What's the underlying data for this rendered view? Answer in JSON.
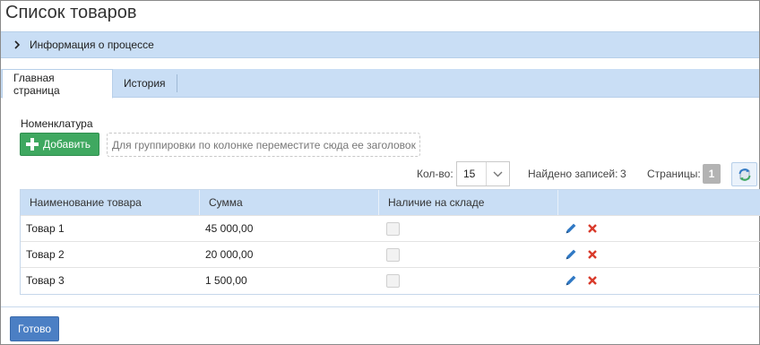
{
  "page": {
    "title": "Список товаров"
  },
  "process_panel": {
    "label": "Информация о процессе",
    "expanded": false
  },
  "tabs": [
    {
      "label": "Главная страница",
      "active": true
    },
    {
      "label": "История",
      "active": false
    }
  ],
  "nomenclature": {
    "section_label": "Номенклатура",
    "add_button": "Добавить",
    "group_hint": "Для группировки по колонке переместите сюда ее заголовок"
  },
  "pager": {
    "count_label": "Кол-во:",
    "count_value": "15",
    "found_label": "Найдено записей:",
    "found_value": "3",
    "pages_label": "Страницы:",
    "current_page": "1"
  },
  "table": {
    "columns": [
      "Наименование товара",
      "Сумма",
      "Наличие на складе",
      ""
    ],
    "rows": [
      {
        "name": "Товар 1",
        "sum": "45 000,00",
        "in_stock": false
      },
      {
        "name": "Товар 2",
        "sum": "20 000,00",
        "in_stock": false
      },
      {
        "name": "Товар 3",
        "sum": "1 500,00",
        "in_stock": false
      }
    ]
  },
  "footer": {
    "done_button": "Готово"
  },
  "colors": {
    "accent_blue": "#c9def5",
    "add_green": "#3fa860",
    "done_blue": "#4b7fc4",
    "edit_icon": "#2f78c4",
    "delete_icon": "#d93a2b"
  }
}
